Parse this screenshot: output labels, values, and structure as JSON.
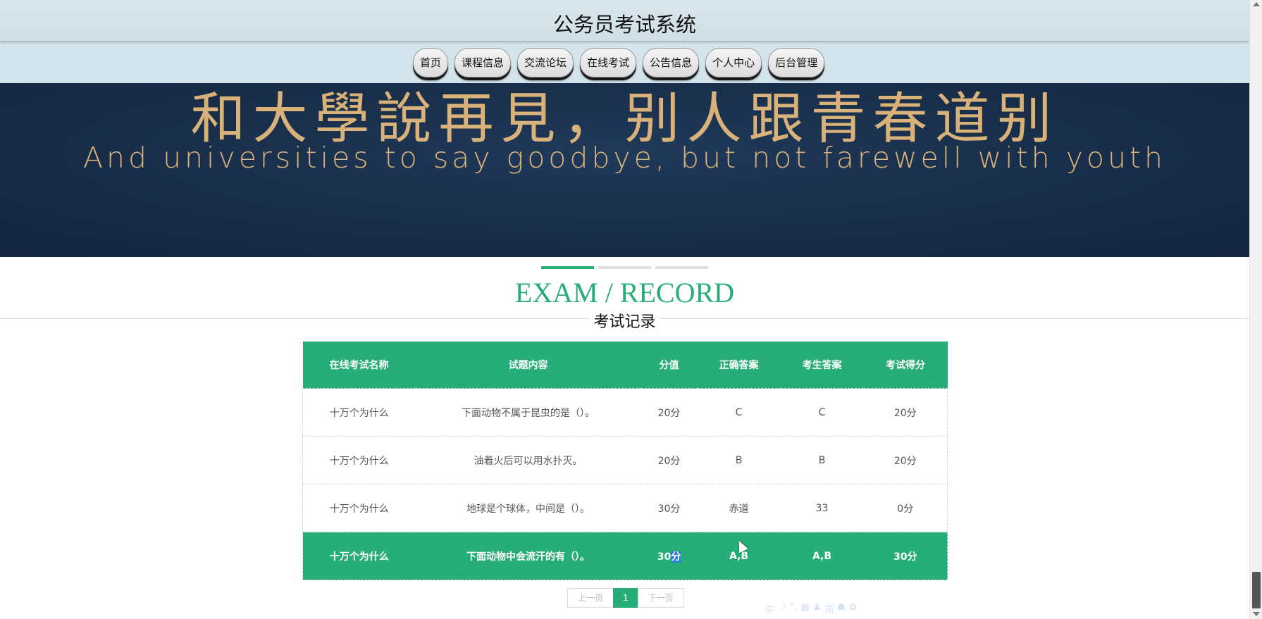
{
  "header": {
    "title": "公务员考试系统"
  },
  "nav": {
    "items": [
      {
        "label": "首页"
      },
      {
        "label": "课程信息"
      },
      {
        "label": "交流论坛"
      },
      {
        "label": "在线考试"
      },
      {
        "label": "公告信息"
      },
      {
        "label": "个人中心"
      },
      {
        "label": "后台管理"
      }
    ]
  },
  "banner": {
    "text_cn": "和大學說再見，别人跟青春道别",
    "text_en": "And universities to say goodbye, but not farewell with youth"
  },
  "section": {
    "title_en": "EXAM / RECORD",
    "title_cn": "考试记录"
  },
  "table": {
    "headers": [
      "在线考试名称",
      "试题内容",
      "分值",
      "正确答案",
      "考生答案",
      "考试得分"
    ],
    "rows": [
      [
        "十万个为什么",
        "下面动物不属于昆虫的是（）。",
        "20分",
        "C",
        "C",
        "20分"
      ],
      [
        "十万个为什么",
        "油着火后可以用水扑灭。",
        "20分",
        "B",
        "B",
        "20分"
      ],
      [
        "十万个为什么",
        "地球是个球体，中间是（）。",
        "30分",
        "赤道",
        "33",
        "0分"
      ],
      [
        "十万个为什么",
        "下面动物中会流汗的有（）。",
        "30",
        "A,B",
        "A,B",
        "30分"
      ]
    ],
    "selected_suffix": "分"
  },
  "pagination": {
    "prev": "上一页",
    "current": "1",
    "next": "下一页"
  },
  "ime": {
    "glyphs": [
      "中",
      "☽",
      "°,",
      "▦",
      "♟",
      "简",
      "☗",
      "✿"
    ]
  },
  "colors": {
    "accent": "#26ad78",
    "header_bg": "#d3e4ec",
    "banner_bg": "#172c47",
    "banner_text": "#d9b27a"
  }
}
